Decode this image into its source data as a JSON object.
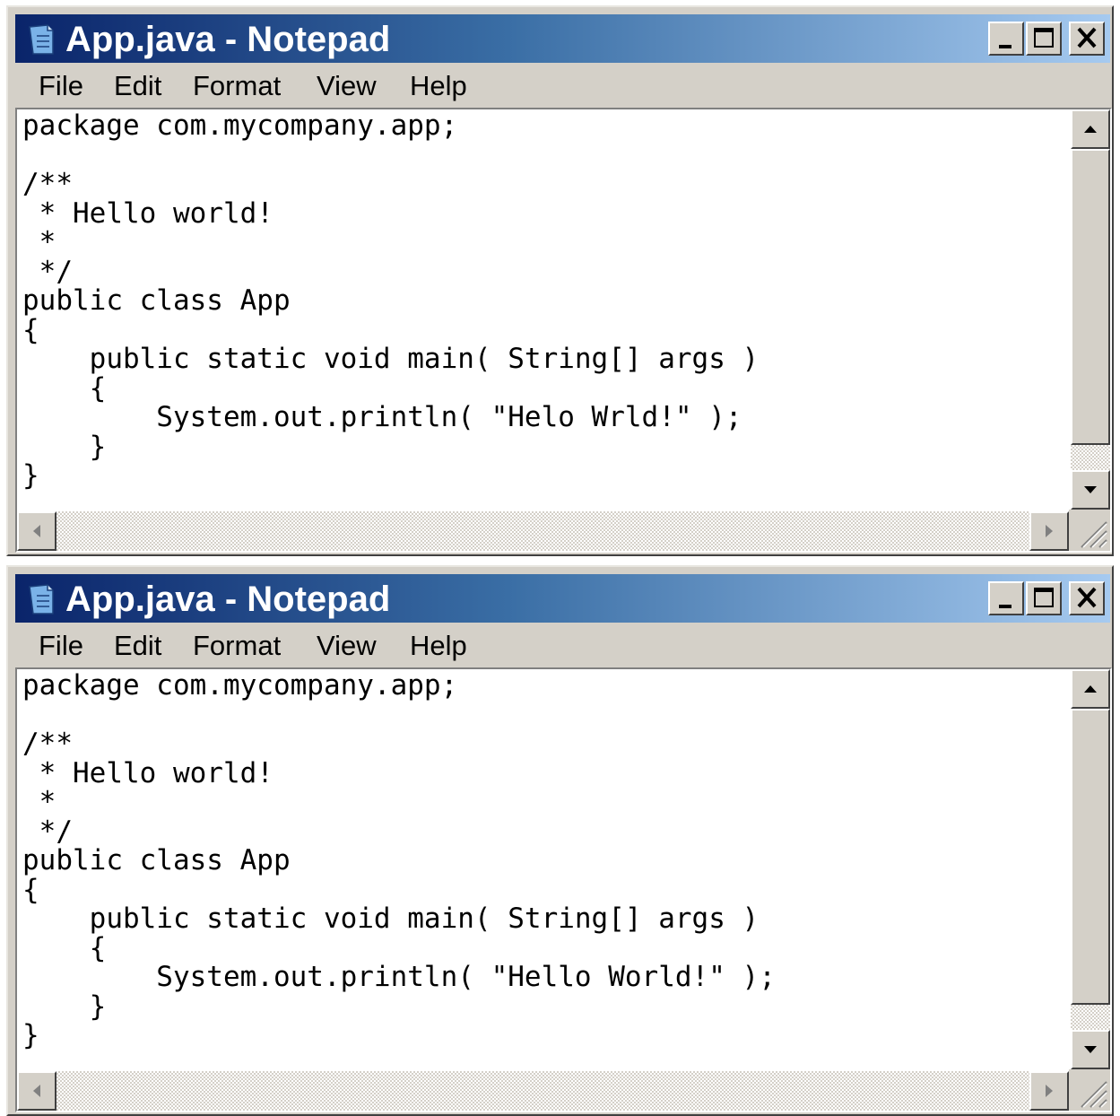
{
  "windows": [
    {
      "title": "App.java - Notepad",
      "menu": [
        "File",
        "Edit",
        "Format",
        "View",
        "Help"
      ],
      "menu_underlined": true,
      "code": "package com.mycompany.app;\n\n/**\n * Hello world!\n *\n */\npublic class App\n{\n    public static void main( String[] args )\n    {\n        System.out.println( \"Helo Wrld!\" );\n    }\n}"
    },
    {
      "title": "App.java - Notepad",
      "menu": [
        "File",
        "Edit",
        "Format",
        "View",
        "Help"
      ],
      "menu_underlined": false,
      "code": "package com.mycompany.app;\n\n/**\n * Hello world!\n *\n */\npublic class App\n{\n    public static void main( String[] args )\n    {\n        System.out.println( \"Hello World!\" );\n    }\n}"
    }
  ],
  "icons": {
    "app": "notepad-icon",
    "minimize": "minimize-icon",
    "maximize": "maximize-icon",
    "close": "close-icon",
    "scroll_up": "arrow-up-icon",
    "scroll_down": "arrow-down-icon",
    "scroll_left": "arrow-left-icon",
    "scroll_right": "arrow-right-icon",
    "grip": "resize-grip-icon"
  },
  "colors": {
    "titlebar_start": "#0a246a",
    "titlebar_end": "#a6caf0",
    "chrome": "#d4d0c8",
    "editor_bg": "#ffffff"
  }
}
